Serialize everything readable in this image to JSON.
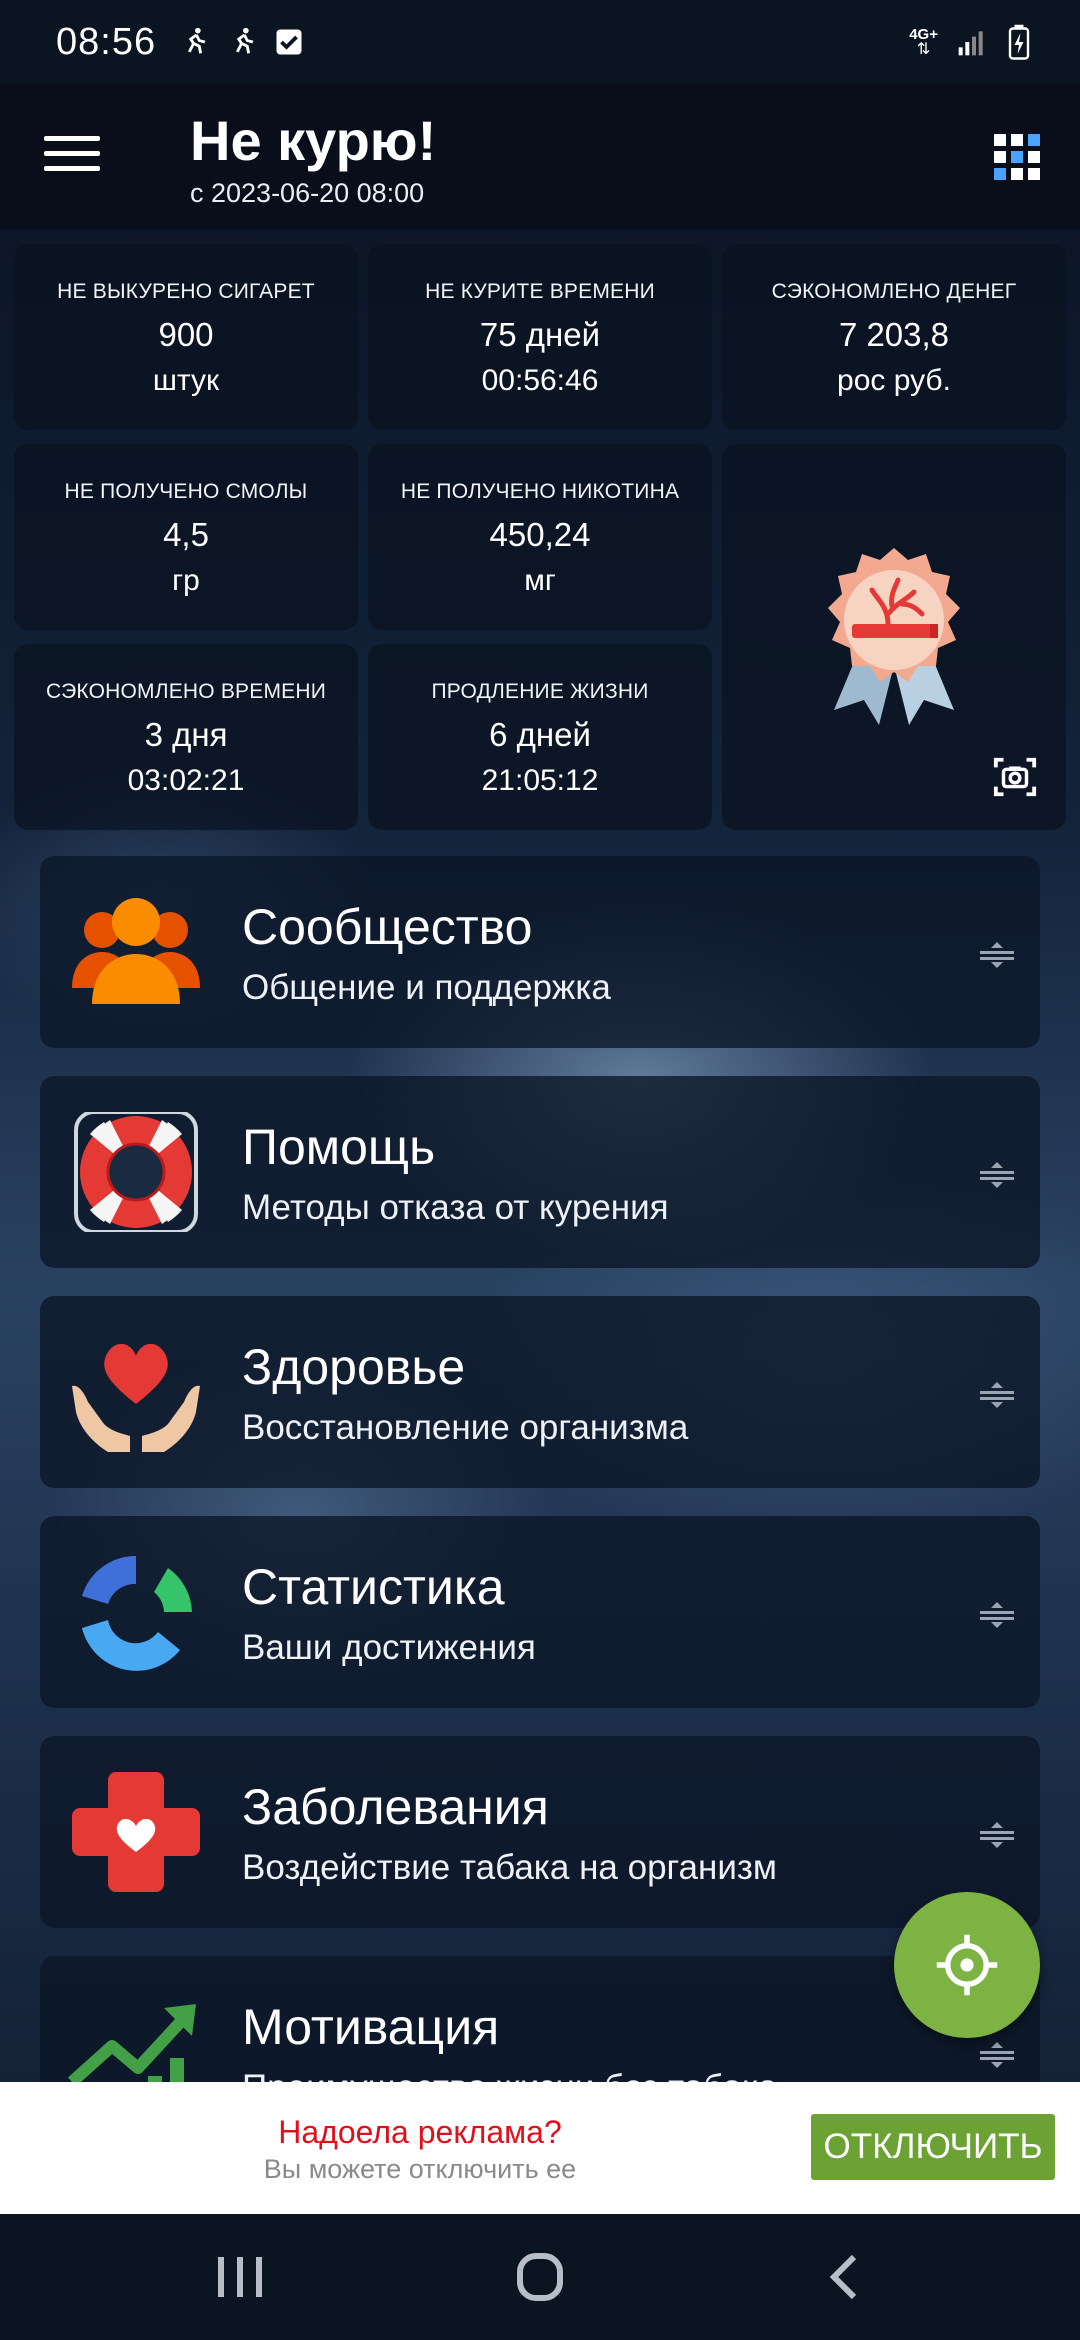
{
  "status_bar": {
    "time": "08:56",
    "network": "4G+"
  },
  "app_bar": {
    "title": "Не курю!",
    "subtitle": "с 2023-06-20 08:00"
  },
  "stats": [
    {
      "label": "НЕ ВЫКУРЕНО СИГАРЕТ",
      "value": "900",
      "unit": "штук"
    },
    {
      "label": "НЕ КУРИТЕ ВРЕМЕНИ",
      "value": "75 дней",
      "unit": "00:56:46"
    },
    {
      "label": "СЭКОНОМЛЕНО ДЕНЕГ",
      "value": "7 203,8",
      "unit": "рос руб."
    },
    {
      "label": "НЕ ПОЛУЧЕНО СМОЛЫ",
      "value": "4,5",
      "unit": "гр"
    },
    {
      "label": "НЕ ПОЛУЧЕНО НИКОТИНА",
      "value": "450,24",
      "unit": "мг"
    },
    {
      "label": "СЭКОНОМЛЕНО ВРЕМЕНИ",
      "value": "3 дня",
      "unit": "03:02:21"
    },
    {
      "label": "ПРОДЛЕНИЕ ЖИЗНИ",
      "value": "6 дней",
      "unit": "21:05:12"
    }
  ],
  "menu": [
    {
      "title": "Сообщество",
      "subtitle": "Общение и поддержка",
      "icon": "community-icon"
    },
    {
      "title": "Помощь",
      "subtitle": "Методы отказа от курения",
      "icon": "lifebuoy-icon"
    },
    {
      "title": "Здоровье",
      "subtitle": "Восстановление организма",
      "icon": "heart-hands-icon"
    },
    {
      "title": "Статистика",
      "subtitle": "Ваши достижения",
      "icon": "statistics-icon"
    },
    {
      "title": "Заболевания",
      "subtitle": "Воздействие табака на организм",
      "icon": "medical-cross-icon"
    },
    {
      "title": "Мотивация",
      "subtitle": "Преимущества жизни без табака",
      "icon": "growth-chart-icon"
    }
  ],
  "ad": {
    "title": "Надоела реклама?",
    "subtitle": "Вы можете отключить ее",
    "button": "ОТКЛЮЧИТЬ"
  },
  "colors": {
    "fab": "#7cb342",
    "ad_button": "#6ca234",
    "ad_title": "#e0101a"
  }
}
